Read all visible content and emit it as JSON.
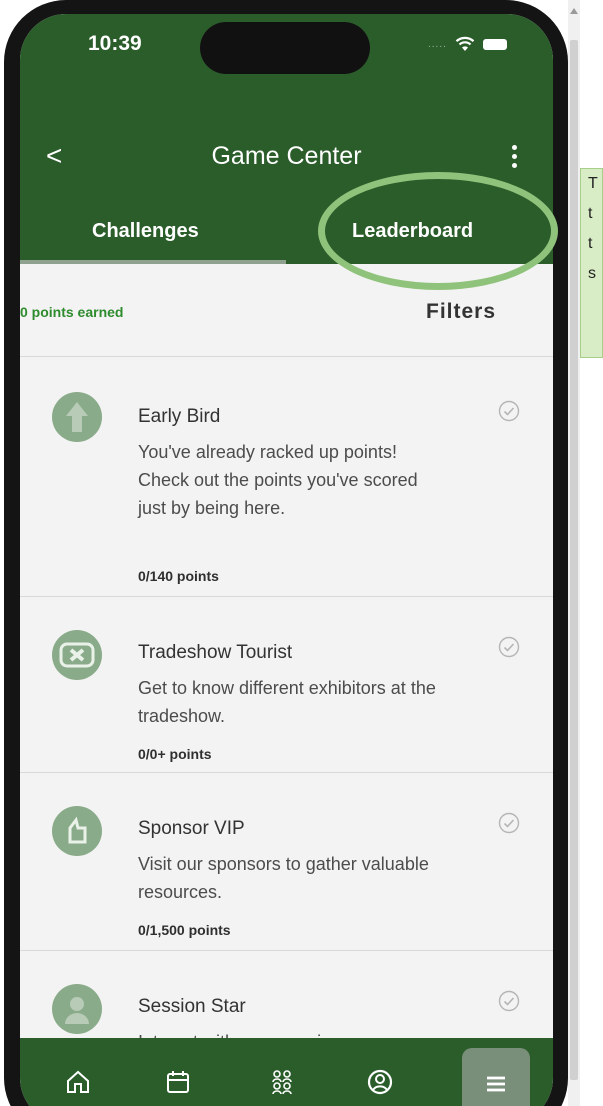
{
  "status_bar": {
    "time": "10:39",
    "signal": "....."
  },
  "header": {
    "back_label": "<",
    "title": "Game Center"
  },
  "tabs": [
    {
      "label": "Challenges",
      "active": true
    },
    {
      "label": "Leaderboard",
      "active": false
    }
  ],
  "summary": {
    "points_earned": "0 points earned",
    "filters_label": "Filters"
  },
  "challenges": [
    {
      "title": "Early Bird",
      "description": "You've already racked up points! Check out the points you've scored just by being here.",
      "points": "0/140 points",
      "icon": "sunrise-icon"
    },
    {
      "title": "Tradeshow Tourist",
      "description": "Get to know different exhibitors at the tradeshow.",
      "points": "0/0+ points",
      "icon": "ticket-icon"
    },
    {
      "title": "Sponsor VIP",
      "description": "Visit our sponsors to gather valuable resources.",
      "points": "0/1,500 points",
      "icon": "badge-icon"
    },
    {
      "title": "Session Star",
      "description": "Interact with your sessions",
      "points": "",
      "icon": "star-person-icon"
    }
  ],
  "bottom_nav": [
    {
      "icon": "home-icon"
    },
    {
      "icon": "calendar-icon"
    },
    {
      "icon": "attendees-icon"
    },
    {
      "icon": "profile-icon"
    },
    {
      "icon": "menu-icon",
      "active": true
    }
  ],
  "tooltip": {
    "lines": [
      "T",
      "t",
      "t",
      "s"
    ]
  },
  "colors": {
    "header": "#2b5d2b",
    "accent": "#2e8b2e",
    "annotation": "#8fc27a",
    "tooltip_bg": "#d8ecc5"
  }
}
